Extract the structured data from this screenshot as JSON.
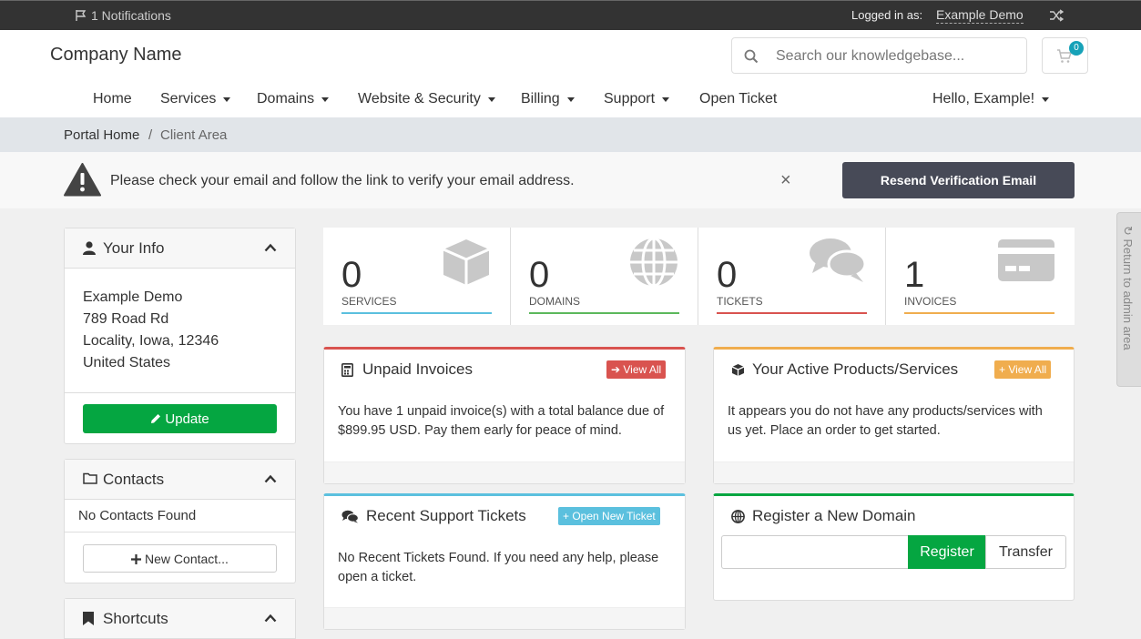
{
  "topbar": {
    "notifications": "1 Notifications",
    "logged_in_label": "Logged in as:",
    "user_name": "Example Demo"
  },
  "header": {
    "company": "Company Name",
    "search_placeholder": "Search our knowledgebase...",
    "cart_count": "0"
  },
  "nav": {
    "home": "Home",
    "services": "Services",
    "domains": "Domains",
    "website_security": "Website & Security",
    "billing": "Billing",
    "support": "Support",
    "open_ticket": "Open Ticket",
    "account": "Hello, Example!"
  },
  "breadcrumb": {
    "home": "Portal Home",
    "separator": "/",
    "current": "Client Area"
  },
  "alert": {
    "message": "Please check your email and follow the link to verify your email address.",
    "close": "×",
    "button": "Resend Verification Email"
  },
  "sidebar": {
    "your_info": {
      "title": "Your Info",
      "name": "Example Demo",
      "address1": "789 Road Rd",
      "address2": "Locality, Iowa, 12346",
      "country": "United States",
      "update_button": "Update"
    },
    "contacts": {
      "title": "Contacts",
      "empty": "No Contacts Found",
      "new_button": "New Contact..."
    },
    "shortcuts": {
      "title": "Shortcuts"
    }
  },
  "stats": [
    {
      "value": "0",
      "label": "SERVICES",
      "color": "#5bc0de",
      "icon": "cube-icon"
    },
    {
      "value": "0",
      "label": "DOMAINS",
      "color": "#5cb85c",
      "icon": "globe-icon"
    },
    {
      "value": "0",
      "label": "TICKETS",
      "color": "#d9534f",
      "icon": "comments-icon"
    },
    {
      "value": "1",
      "label": "INVOICES",
      "color": "#f0ad4e",
      "icon": "credit-card-icon"
    }
  ],
  "cards": {
    "unpaid": {
      "title": "Unpaid Invoices",
      "button": "View All",
      "text": "You have 1 unpaid invoice(s) with a total balance due of $899.95 USD. Pay them early for peace of mind."
    },
    "products": {
      "title": "Your Active Products/Services",
      "button": "View All",
      "text": "It appears you do not have any products/services with us yet. Place an order to get started."
    },
    "tickets": {
      "title": "Recent Support Tickets",
      "button": "Open New Ticket",
      "text": "No Recent Tickets Found. If you need any help, please open a ticket."
    },
    "domain": {
      "title": "Register a New Domain",
      "register": "Register",
      "transfer": "Transfer"
    }
  },
  "admin_tab": "Return to admin area",
  "colors": {
    "green": "#05a641",
    "red": "#d9534f",
    "orange": "#f0ad4e",
    "blue": "#5bc0de"
  }
}
